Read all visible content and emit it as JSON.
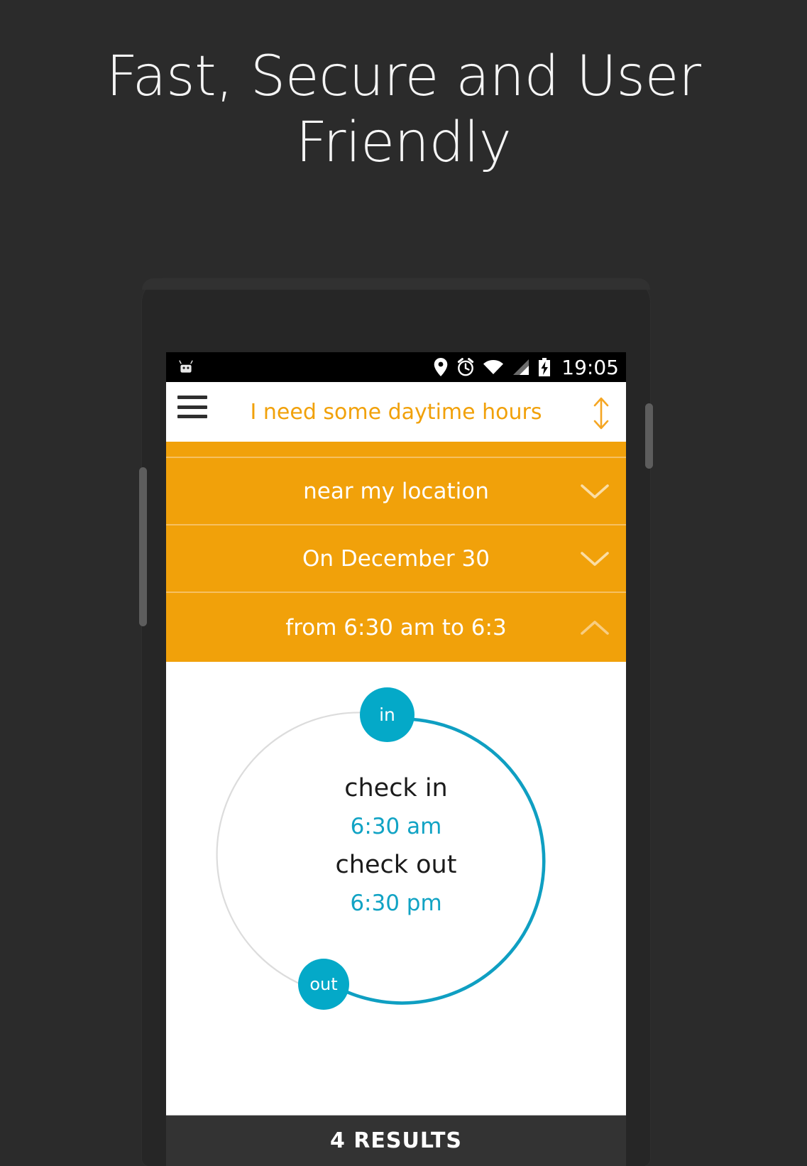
{
  "promo": {
    "headline": "Fast, Secure and User\nFriendly",
    "background_color": "#2b2b2b",
    "headline_color": "#f4f4f4"
  },
  "theme": {
    "accent_orange": "#f1a10a",
    "accent_teal": "#04a9c8",
    "teal_text": "#11a3c4",
    "divider_orange": "#f6c061",
    "results_bar": "#333333"
  },
  "statusbar": {
    "left_icon": "android-robot-icon",
    "icons": [
      "location-pin-icon",
      "alarm-clock-icon",
      "wifi-icon",
      "cell-signal-icon",
      "battery-charging-icon"
    ],
    "clock": "19:05"
  },
  "appbar": {
    "menu_icon": "hamburger-menu-icon",
    "title": "I need some daytime hours",
    "sort_icon": "vertical-double-arrow-icon"
  },
  "filters": [
    {
      "label": "near my location",
      "chevron": "chevron-down-icon",
      "expanded": false
    },
    {
      "label": "On December 30",
      "chevron": "chevron-down-icon",
      "expanded": false
    },
    {
      "label": "from 6:30 am to 6:3",
      "chevron": "chevron-up-icon",
      "expanded": true
    }
  ],
  "time_picker": {
    "in_handle_label": "in",
    "out_handle_label": "out",
    "check_in_label": "check in",
    "check_in_time": "6:30 am",
    "check_out_label": "check out",
    "check_out_time": "6:30 pm",
    "arc_color": "#11a3c4",
    "track_color": "#dddddd"
  },
  "results": {
    "label": "4 RESULTS"
  }
}
